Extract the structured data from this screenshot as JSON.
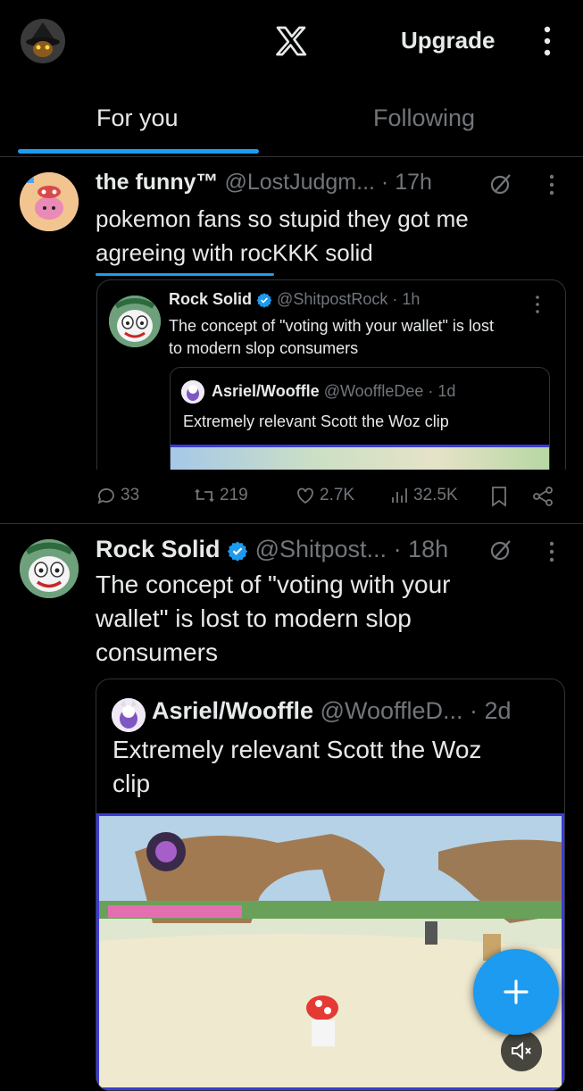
{
  "header": {
    "upgrade_label": "Upgrade",
    "brand_icon": "x-logo-icon",
    "accent": "#1d9bf0"
  },
  "tabs": [
    {
      "label": "For you",
      "active": true
    },
    {
      "label": "Following",
      "active": false
    }
  ],
  "posts": [
    {
      "name": "the funny™",
      "handle": "@LostJudgm...",
      "time": "· 17h",
      "text_lines": [
        "pokemon fans so stupid they got me",
        "agreeing with rocKKK solid"
      ],
      "quote": {
        "name": "Rock Solid",
        "handle": "@ShitpostRock · 1h",
        "text_lines": [
          "The concept of \"voting with your wallet\" is lost",
          "to modern slop consumers"
        ],
        "nested_quote": {
          "name": "Asriel/Wooffle",
          "handle": "@WooffleDee · 1d",
          "text": "Extremely relevant Scott the Woz clip"
        }
      },
      "actions": {
        "replies": "33",
        "reposts": "219",
        "likes": "2.7K",
        "views": "32.5K"
      }
    },
    {
      "name": "Rock Solid",
      "handle": "@Shitpost...",
      "time": "· 18h",
      "text_lines": [
        "The concept of \"voting with your",
        "wallet\" is lost to modern slop",
        "consumers"
      ],
      "quote": {
        "name": "Asriel/Wooffle",
        "handle": "@WooffleD...",
        "time": "· 2d",
        "text_lines": [
          "Extremely relevant Scott the Woz",
          "clip"
        ]
      }
    }
  ]
}
